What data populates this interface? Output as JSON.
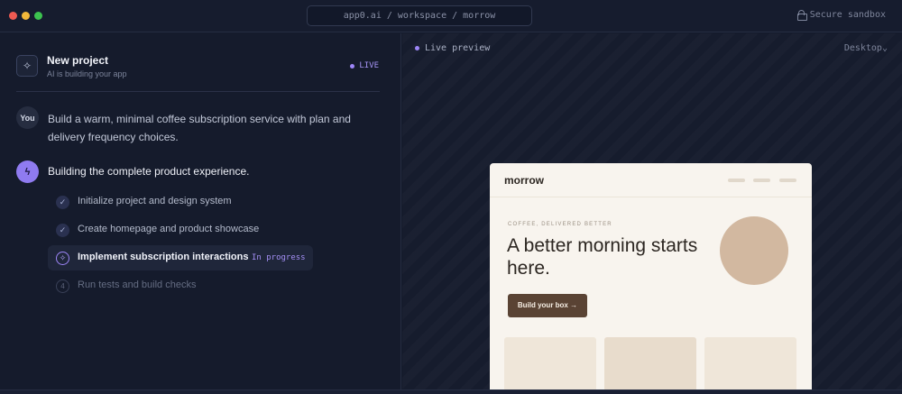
{
  "window": {
    "url": "app0.ai / workspace / morrow",
    "secure_label": "Secure sandbox"
  },
  "project": {
    "title": "New project",
    "subtitle": "AI is building your app",
    "live_label": "LIVE",
    "project_icon": "sparkle-icon"
  },
  "chat": {
    "user_avatar": "You",
    "user_message": "Build a warm, minimal coffee subscription service with plan and delivery frequency choices.",
    "assistant_icon": "bolt-icon",
    "build_title": "Building the complete product experience."
  },
  "steps": [
    {
      "label": "Initialize project and design system",
      "state": "done",
      "icon": "check-icon",
      "glyph": "✓"
    },
    {
      "label": "Create homepage and product showcase",
      "state": "done",
      "icon": "check-icon",
      "glyph": "✓"
    },
    {
      "label": "Implement subscription interactions",
      "state": "active",
      "icon": "sparkle-icon",
      "glyph": "✧",
      "status": "In progress"
    },
    {
      "label": "Run tests and build checks",
      "state": "pending",
      "icon": "step-number-icon",
      "glyph": "4"
    }
  ],
  "preview": {
    "label": "Live preview",
    "device": "Desktop"
  },
  "site": {
    "logo": "morrow",
    "eyebrow": "COFFEE, DELIVERED BETTER",
    "headline": "A better morning starts here.",
    "cta": "Build your box →"
  },
  "colors": {
    "accent": "#9d86f8",
    "site_bg": "#f8f4ee",
    "cta_bg": "#5a4334",
    "hero_circle": "#d2b8a0"
  }
}
